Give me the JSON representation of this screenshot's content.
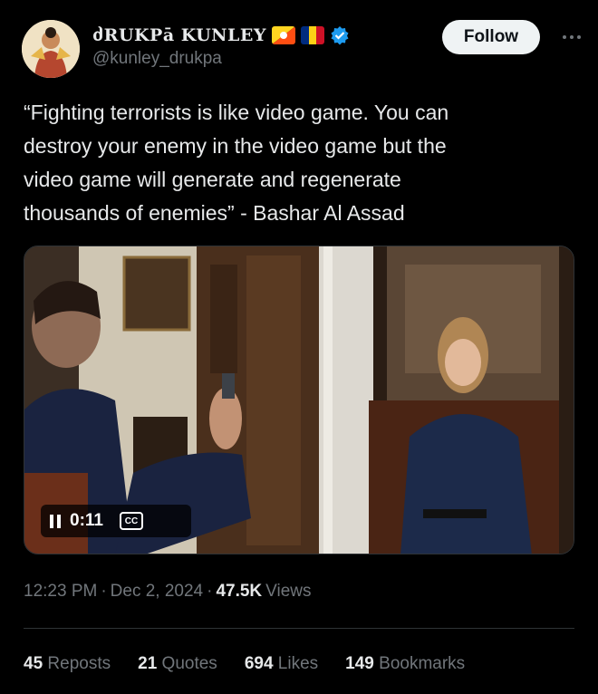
{
  "author": {
    "display_name": "ძRUKPā KUNLEY",
    "handle": "@kunley_drukpa",
    "flags": [
      "bhutan-flag",
      "romania-flag"
    ],
    "verified": true
  },
  "actions": {
    "follow_label": "Follow",
    "more_icon": "more-horizontal-icon"
  },
  "tweet": {
    "text": "“Fighting terrorists is like video game. You can\ndestroy your enemy in the video game but the\nvideo game will generate and regenerate\nthousands of enemies” - Bashar Al Assad"
  },
  "video": {
    "elapsed": "0:11",
    "cc_label": "CC",
    "state": "playing"
  },
  "meta": {
    "time": "12:23 PM",
    "sep1": "·",
    "date": "Dec 2, 2024",
    "sep2": "·",
    "views_count": "47.5K",
    "views_label": "Views"
  },
  "stats": [
    {
      "count": "45",
      "label": "Reposts"
    },
    {
      "count": "21",
      "label": "Quotes"
    },
    {
      "count": "694",
      "label": "Likes"
    },
    {
      "count": "149",
      "label": "Bookmarks"
    }
  ],
  "colors": {
    "background": "#000000",
    "text": "#e7e9ea",
    "muted": "#71767b",
    "verified": "#1d9bf0",
    "follow_bg": "#eff3f4"
  }
}
